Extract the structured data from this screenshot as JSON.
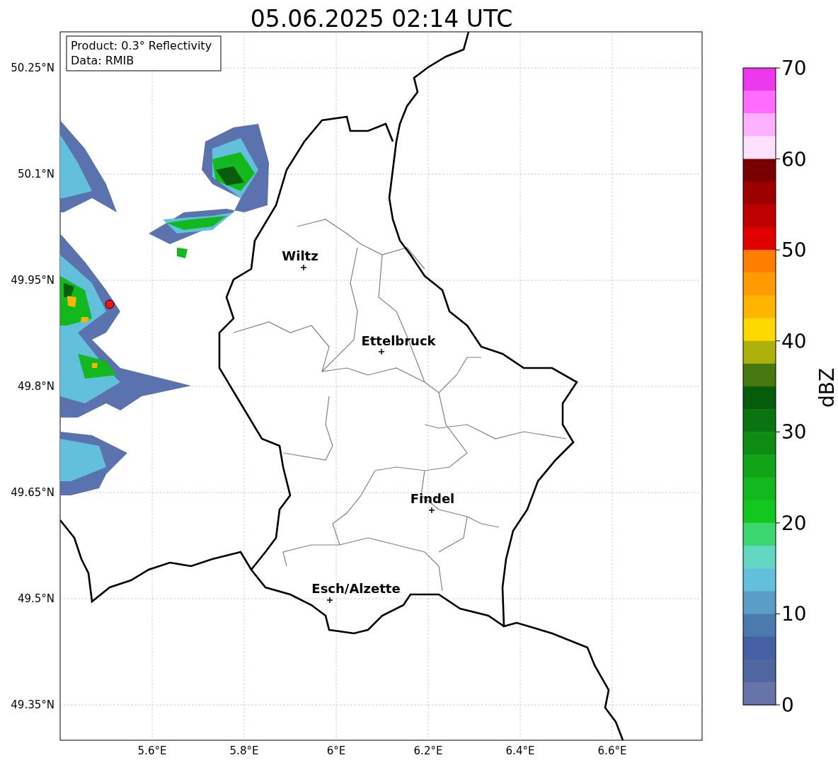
{
  "title": "05.06.2025 02:14 UTC",
  "info_box": {
    "lines": [
      "Product: 0.3° Reflectivity",
      "Data: RMIB"
    ]
  },
  "map": {
    "lat_ticks": [
      "50.25°N",
      "50.1°N",
      "49.95°N",
      "49.8°N",
      "49.65°N",
      "49.5°N",
      "49.35°N"
    ],
    "lon_ticks": [
      "5.6°E",
      "5.8°E",
      "6°E",
      "6.2°E",
      "6.4°E",
      "6.6°E"
    ],
    "cities": [
      {
        "name": "Wiltz"
      },
      {
        "name": "Ettelbruck"
      },
      {
        "name": "Findel"
      },
      {
        "name": "Esch/Alzette"
      }
    ]
  },
  "colorbar": {
    "label": "dBZ",
    "ticks": [
      "70",
      "60",
      "50",
      "40",
      "30",
      "20",
      "10",
      "0"
    ],
    "bins": [
      {
        "color": "#ec38ec"
      },
      {
        "color": "#ff6cff"
      },
      {
        "color": "#ffb0ff"
      },
      {
        "color": "#ffe0ff"
      },
      {
        "color": "#7a0000"
      },
      {
        "color": "#9e0000"
      },
      {
        "color": "#be0000"
      },
      {
        "color": "#e00000"
      },
      {
        "color": "#ff7e00"
      },
      {
        "color": "#ff9a00"
      },
      {
        "color": "#ffb400"
      },
      {
        "color": "#ffd800"
      },
      {
        "color": "#b0b00a"
      },
      {
        "color": "#467810"
      },
      {
        "color": "#065e0c"
      },
      {
        "color": "#0a7410"
      },
      {
        "color": "#0e8c14"
      },
      {
        "color": "#10a416"
      },
      {
        "color": "#12b81e"
      },
      {
        "color": "#12c81e"
      },
      {
        "color": "#3cd66e"
      },
      {
        "color": "#62d8c4"
      },
      {
        "color": "#62c0dc"
      },
      {
        "color": "#5a9ec8"
      },
      {
        "color": "#4a7ab0"
      },
      {
        "color": "#4460a2"
      },
      {
        "color": "#5066a0"
      },
      {
        "color": "#6674a8"
      }
    ]
  }
}
